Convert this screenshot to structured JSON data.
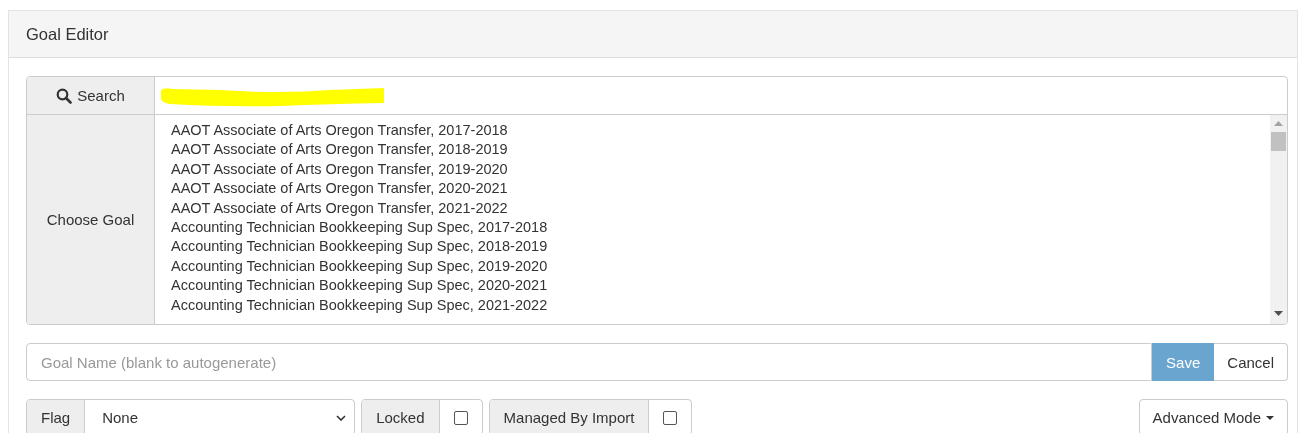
{
  "panel": {
    "title": "Goal Editor"
  },
  "search": {
    "label": "Search"
  },
  "goal_list": {
    "label": "Choose Goal",
    "items": [
      "AAOT Associate of Arts Oregon Transfer, 2017-2018",
      "AAOT Associate of Arts Oregon Transfer, 2018-2019",
      "AAOT Associate of Arts Oregon Transfer, 2019-2020",
      "AAOT Associate of Arts Oregon Transfer, 2020-2021",
      "AAOT Associate of Arts Oregon Transfer, 2021-2022",
      "Accounting Technician Bookkeeping Sup Spec, 2017-2018",
      "Accounting Technician Bookkeeping Sup Spec, 2018-2019",
      "Accounting Technician Bookkeeping Sup Spec, 2019-2020",
      "Accounting Technician Bookkeeping Sup Spec, 2020-2021",
      "Accounting Technician Bookkeeping Sup Spec, 2021-2022"
    ]
  },
  "goal_name": {
    "placeholder": "Goal Name (blank to autogenerate)"
  },
  "buttons": {
    "save": "Save",
    "cancel": "Cancel"
  },
  "flag": {
    "label": "Flag",
    "value": "None"
  },
  "locked": {
    "label": "Locked",
    "checked": false
  },
  "managed_by_import": {
    "label": "Managed By Import",
    "checked": false
  },
  "advanced_mode": {
    "label": "Advanced Mode"
  }
}
